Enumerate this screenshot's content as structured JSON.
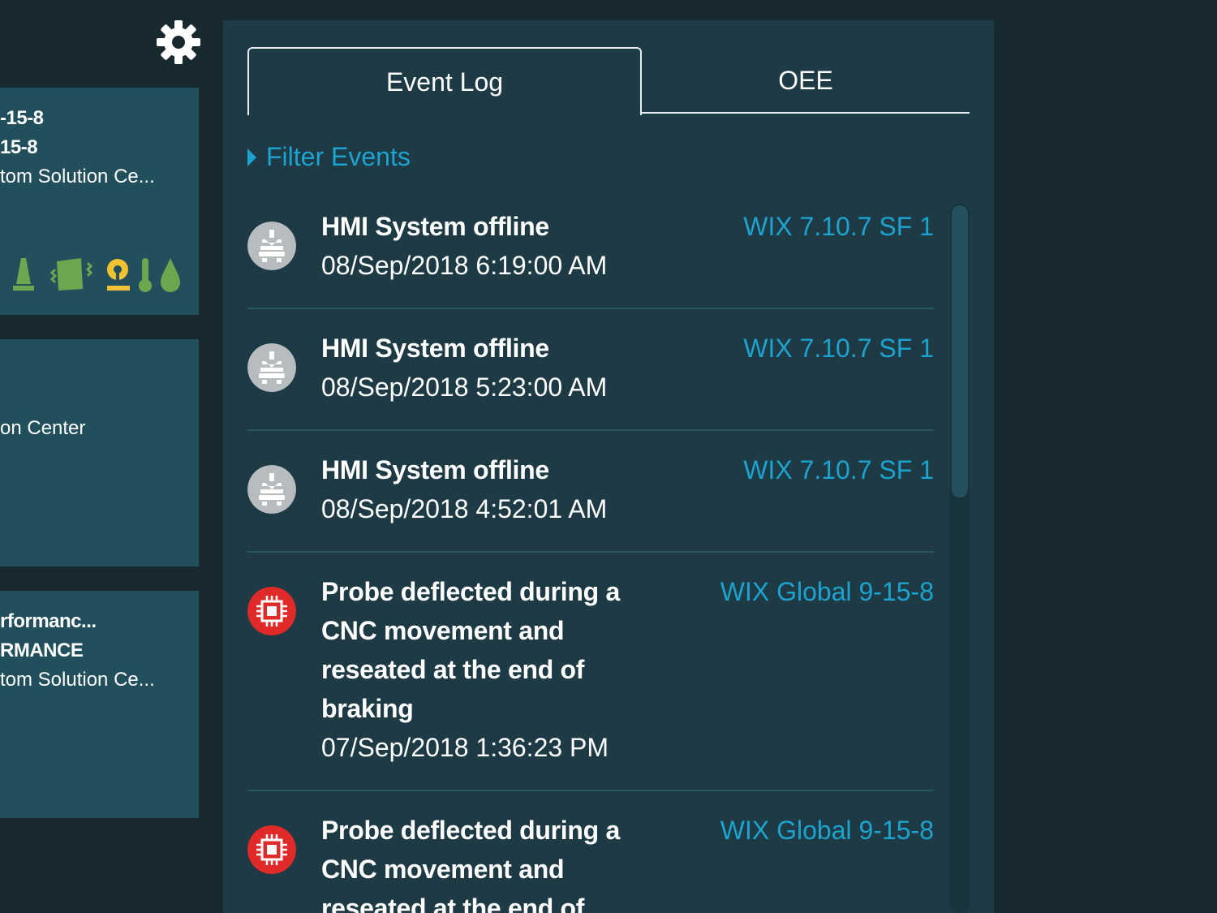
{
  "sidebar": {
    "settings_icon": "gear-icon",
    "cards": [
      {
        "line1": "-15-8",
        "line2": "15-8",
        "line3": "tom Solution Ce...",
        "status_icons": [
          "cone-icon",
          "vibration-icon",
          "operator-icon",
          "temperature-icon",
          "coolant-drop-icon"
        ],
        "status_colors": {
          "green": "#6aa84f",
          "yellow": "#f1c232"
        }
      },
      {
        "line1": "on Center"
      },
      {
        "line1": "rformanc...",
        "line2": "RMANCE",
        "line3": "tom Solution Ce..."
      }
    ]
  },
  "tabs": [
    {
      "label": "Event Log",
      "active": true
    },
    {
      "label": "OEE",
      "active": false
    }
  ],
  "filter": {
    "label": "Filter Events"
  },
  "events": [
    {
      "icon": "hmi-machine-icon",
      "title": "HMI System offline",
      "time": "08/Sep/2018 6:19:00 AM",
      "source": "WIX 7.10.7 SF 1"
    },
    {
      "icon": "hmi-machine-icon",
      "title": "HMI System offline",
      "time": "08/Sep/2018 5:23:00 AM",
      "source": "WIX 7.10.7 SF 1"
    },
    {
      "icon": "hmi-machine-icon",
      "title": "HMI System offline",
      "time": "08/Sep/2018 4:52:01 AM",
      "source": "WIX 7.10.7 SF 1"
    },
    {
      "icon": "cpu-chip-icon",
      "title": "Probe deflected during a CNC movement and reseated at the end of braking",
      "time": "07/Sep/2018 1:36:23 PM",
      "source": "WIX Global 9-15-8"
    },
    {
      "icon": "cpu-chip-icon",
      "title": "Probe deflected during a CNC movement and reseated at the end of",
      "time": "",
      "source": "WIX Global 9-15-8"
    }
  ],
  "colors": {
    "background": "#17292f",
    "panel": "#1d3a45",
    "card": "#214f5c",
    "accent": "#1da3cf",
    "hmi_icon": "#b7bdbf",
    "alarm_icon": "#e02a2a"
  }
}
